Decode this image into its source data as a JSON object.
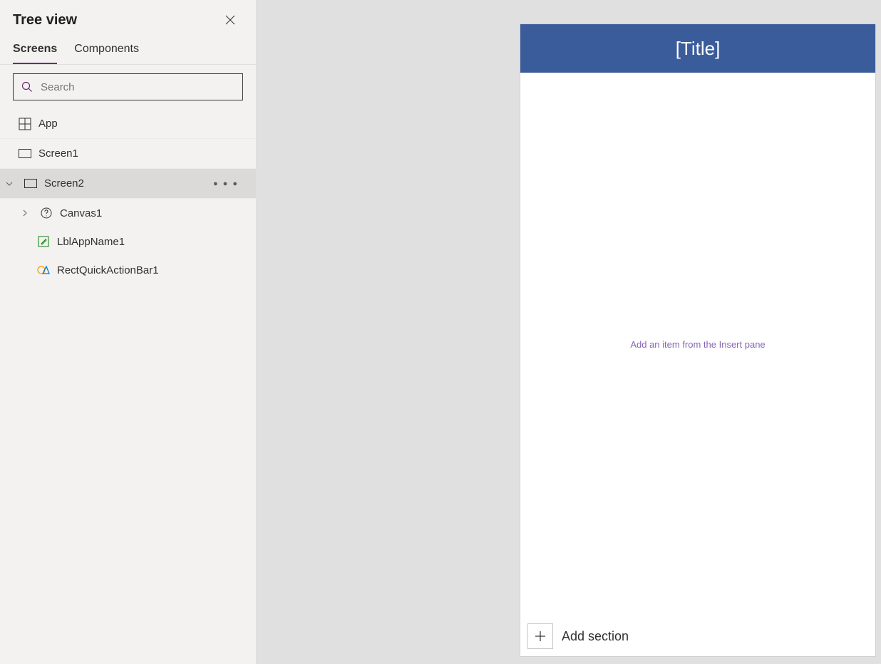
{
  "sidebar": {
    "title": "Tree view",
    "tabs": {
      "screens": "Screens",
      "components": "Components"
    },
    "search_placeholder": "Search"
  },
  "tree": {
    "app": "App",
    "screen1": "Screen1",
    "screen2": "Screen2",
    "canvas1": "Canvas1",
    "lblAppName1": "LblAppName1",
    "rectQuickActionBar1": "RectQuickActionBar1"
  },
  "canvas": {
    "title_placeholder": "[Title]",
    "empty_hint": "Add an item from the Insert pane",
    "add_section": "Add section"
  },
  "colors": {
    "header": "#3b5c9b",
    "accent": "#742774"
  }
}
